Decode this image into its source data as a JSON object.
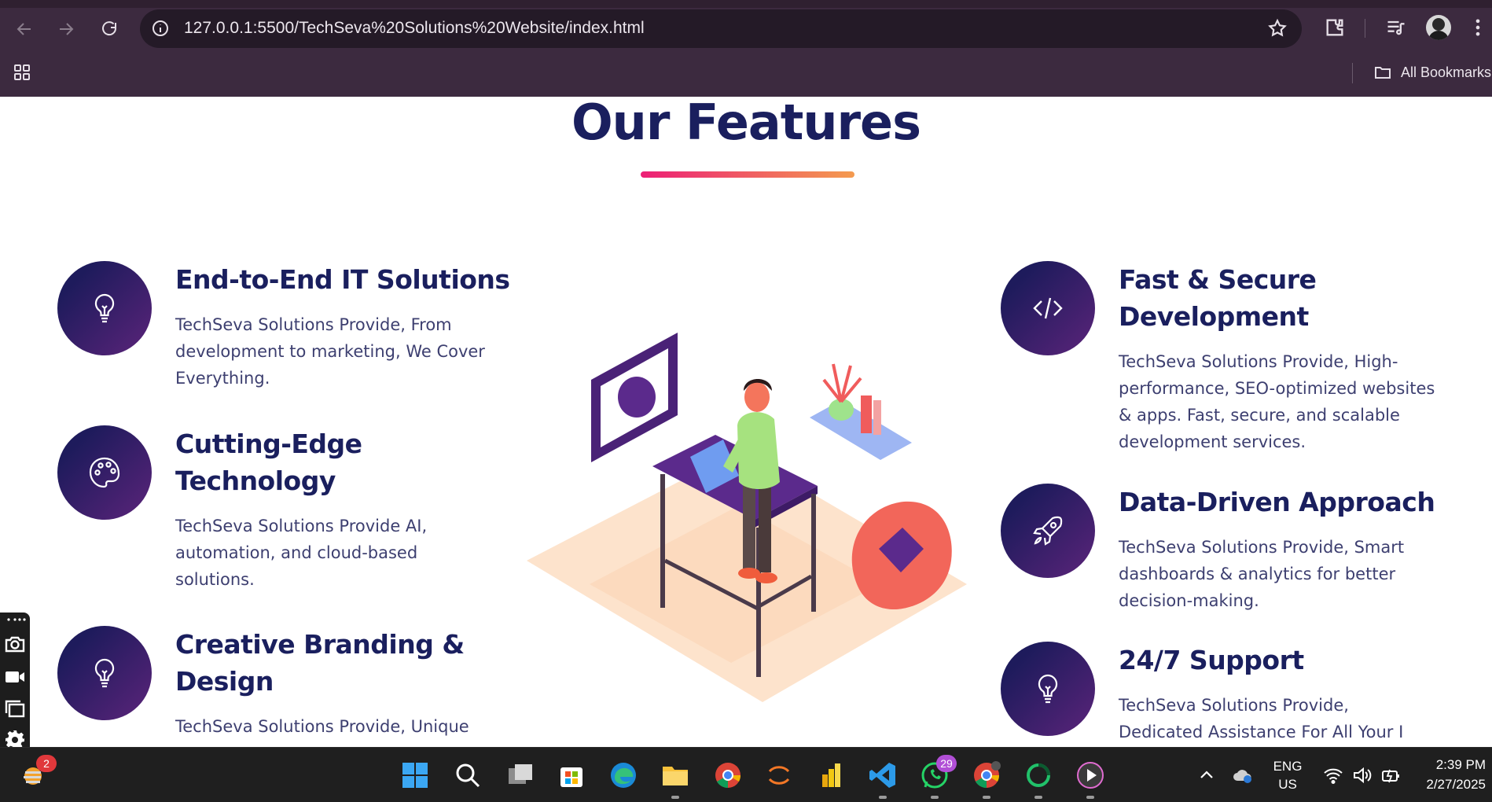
{
  "browser": {
    "url": "127.0.0.1:5500/TechSeva%20Solutions%20Website/index.html",
    "bookmarks_label": "All Bookmarks"
  },
  "section": {
    "title": "Our Features"
  },
  "features_left": [
    {
      "title": "End-to-End IT Solutions",
      "description": "TechSeva Solutions Provide, From development to marketing, We Cover Everything.",
      "icon": "lightbulb-icon"
    },
    {
      "title": "Cutting-Edge Technology",
      "description": "TechSeva Solutions Provide AI, automation, and cloud-based solutions.",
      "icon": "palette-icon"
    },
    {
      "title": "Creative Branding & Design",
      "description": "TechSeva Solutions Provide, Unique",
      "icon": "lightbulb-icon"
    }
  ],
  "features_right": [
    {
      "title": "Fast & Secure Development",
      "description": "TechSeva Solutions Provide, High-performance, SEO-optimized websites & apps. Fast, secure, and scalable development services.",
      "icon": "code-icon"
    },
    {
      "title": "Data-Driven Approach",
      "description": "TechSeva Solutions Provide, Smart dashboards & analytics for better decision-making.",
      "icon": "rocket-icon"
    },
    {
      "title": "24/7 Support",
      "description": "TechSeva Solutions Provide, Dedicated Assistance For All Your I",
      "icon": "lightbulb-icon"
    }
  ],
  "colors": {
    "heading": "#1a1f5e",
    "icon_circle_start": "#1e1b5c",
    "icon_circle_end": "#5b247a",
    "underline_start": "#ec1f76",
    "underline_end": "#f49b4f",
    "scroll_top": "#ee2b78"
  },
  "taskbar": {
    "weather_badge": "2",
    "whatsapp_badge": "29",
    "language_line1": "ENG",
    "language_line2": "US",
    "time": "2:39 PM",
    "date": "2/27/2025"
  }
}
